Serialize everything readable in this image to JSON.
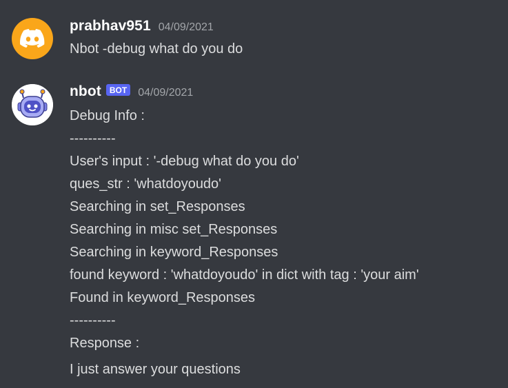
{
  "messages": [
    {
      "username": "prabhav951",
      "timestamp": "04/09/2021",
      "avatar_icon": "discord-logo-icon",
      "avatar_color": "#faa61a",
      "lines": [
        "Nbot -debug what do you do"
      ]
    },
    {
      "username": "nbot",
      "badge": "BOT",
      "badge_color": "#5865f2",
      "timestamp": "04/09/2021",
      "avatar_icon": "robot-icon",
      "lines": [
        "Debug Info :",
        "----------",
        "User's input : '-debug what do you do'",
        "ques_str : 'whatdoyoudo'",
        "Searching in set_Responses",
        "Searching in misc set_Responses",
        "Searching in keyword_Responses",
        "found keyword : 'whatdoyoudo' in dict with tag : 'your aim'",
        "Found in keyword_Responses",
        "----------",
        "Response :"
      ],
      "reply": "I just answer your questions"
    }
  ],
  "colors": {
    "background": "#36393f",
    "text": "#dcddde",
    "timestamp": "#a3a6aa"
  }
}
